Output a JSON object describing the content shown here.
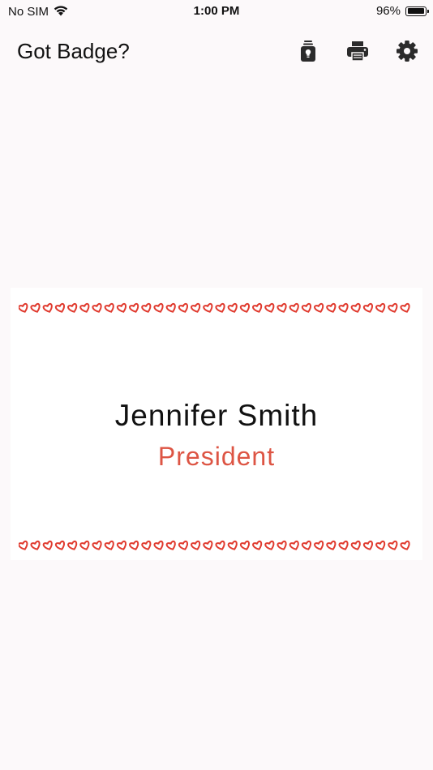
{
  "status_bar": {
    "carrier": "No SIM",
    "time": "1:00 PM",
    "battery_percent_text": "96%",
    "battery_level": 0.96
  },
  "nav": {
    "title": "Got Badge?",
    "icons": [
      "badge-holder-icon",
      "printer-icon",
      "gear-icon"
    ]
  },
  "badge": {
    "name": "Jennifer Smith",
    "title": "President",
    "title_color": "#dd5544",
    "border_color": "#e03a2e",
    "border_icon": "heart-icon"
  },
  "colors": {
    "background": "#fcf9fa",
    "card": "#ffffff",
    "icon": "#2b2b2b"
  }
}
